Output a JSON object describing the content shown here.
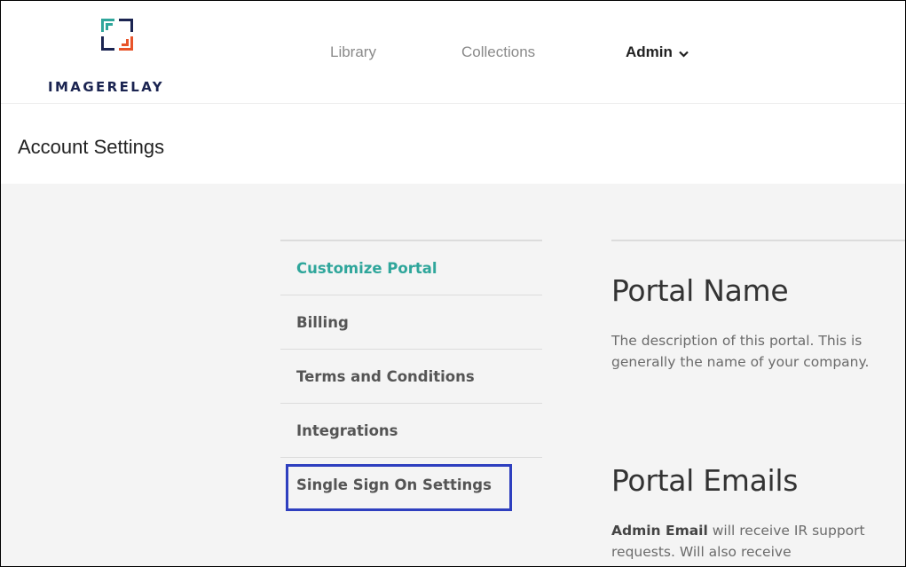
{
  "header": {
    "logo_text": "IMAGERELAY",
    "nav": {
      "library": "Library",
      "collections": "Collections",
      "admin": "Admin"
    }
  },
  "page": {
    "title": "Account Settings"
  },
  "settings_menu": {
    "items": [
      {
        "label": "Customize Portal",
        "active": true
      },
      {
        "label": "Billing"
      },
      {
        "label": "Terms and Conditions"
      },
      {
        "label": "Integrations"
      },
      {
        "label": "Single Sign On Settings",
        "highlighted": true
      }
    ]
  },
  "sections": {
    "portal_name": {
      "title": "Portal Name",
      "description_line1": "The description of this portal. This is",
      "description_line2": "generally the name of your company."
    },
    "portal_emails": {
      "title": "Portal Emails",
      "admin_email_label": "Admin Email",
      "admin_email_text": " will receive IR support",
      "description_line2": "requests. Will also receive"
    }
  },
  "colors": {
    "active_menu": "#2fa69b",
    "highlight_box": "#2e3fbf",
    "logo_navy": "#1b2451",
    "logo_teal": "#2fa69b",
    "logo_orange": "#e8542a"
  }
}
